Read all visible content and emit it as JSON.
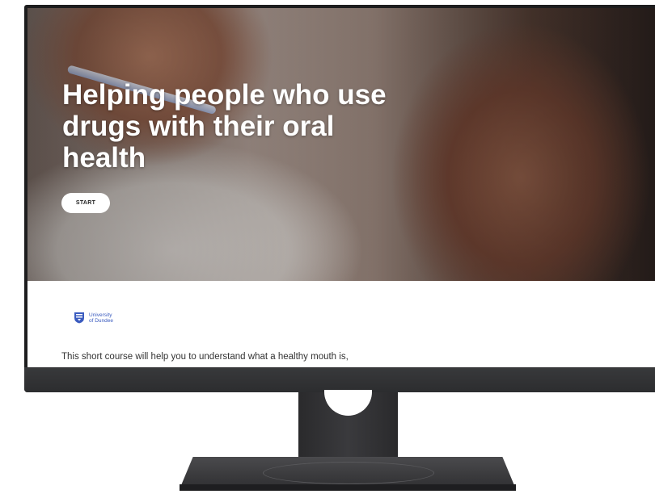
{
  "hero": {
    "title": "Helping people who use drugs with their oral health",
    "start_label": "START",
    "image_icon": "man-brushing-teeth-photo"
  },
  "logo": {
    "line1": "University",
    "line2": "of Dundee",
    "icon": "university-crest-icon",
    "color": "#3a5bbf"
  },
  "content": {
    "intro": "This short course will help you to understand what a healthy mouth is,"
  }
}
